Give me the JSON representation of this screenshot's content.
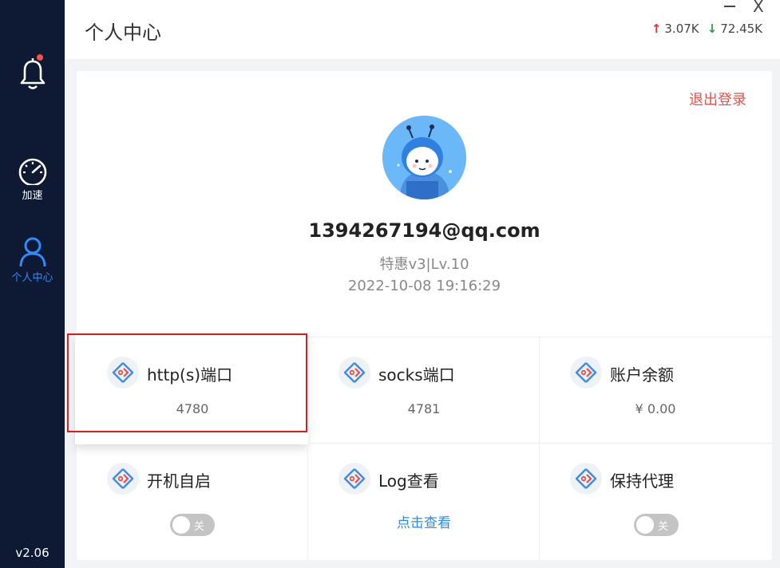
{
  "sidebar": {
    "bell": {
      "icon": "bell-icon",
      "has_notification": true,
      "badge_color": "#ff4d4f"
    },
    "items": [
      {
        "label": "加速",
        "icon": "speedometer-icon",
        "active": false
      },
      {
        "label": "个人中心",
        "icon": "user-icon",
        "active": true
      }
    ],
    "version": "v2.06"
  },
  "header": {
    "title": "个人中心",
    "upload_speed": "3.07K",
    "download_speed": "72.45K",
    "minimize_label": "—",
    "close_label": "X"
  },
  "profile": {
    "logout_label": "退出登录",
    "email": "1394267194@qq.com",
    "level": "特惠v3|Lv.10",
    "login_time": "2022-10-08 19:16:29"
  },
  "cells": [
    {
      "title": "http(s)端口",
      "value": "4780"
    },
    {
      "title": "socks端口",
      "value": "4781"
    },
    {
      "title": "账户余额",
      "value": "¥ 0.00"
    },
    {
      "title": "开机自启",
      "toggle_label": "关",
      "toggle_on": false
    },
    {
      "title": "Log查看",
      "link_label": "点击查看"
    },
    {
      "title": "保持代理",
      "toggle_label": "关",
      "toggle_on": false
    }
  ],
  "colors": {
    "sidebar_bg": "#0e1a33",
    "accent": "#2f8bff",
    "logout": "#e8504a",
    "upload_arrow": "#e03131",
    "download_arrow": "#2e9e3e",
    "highlight_border": "#e0191e"
  }
}
